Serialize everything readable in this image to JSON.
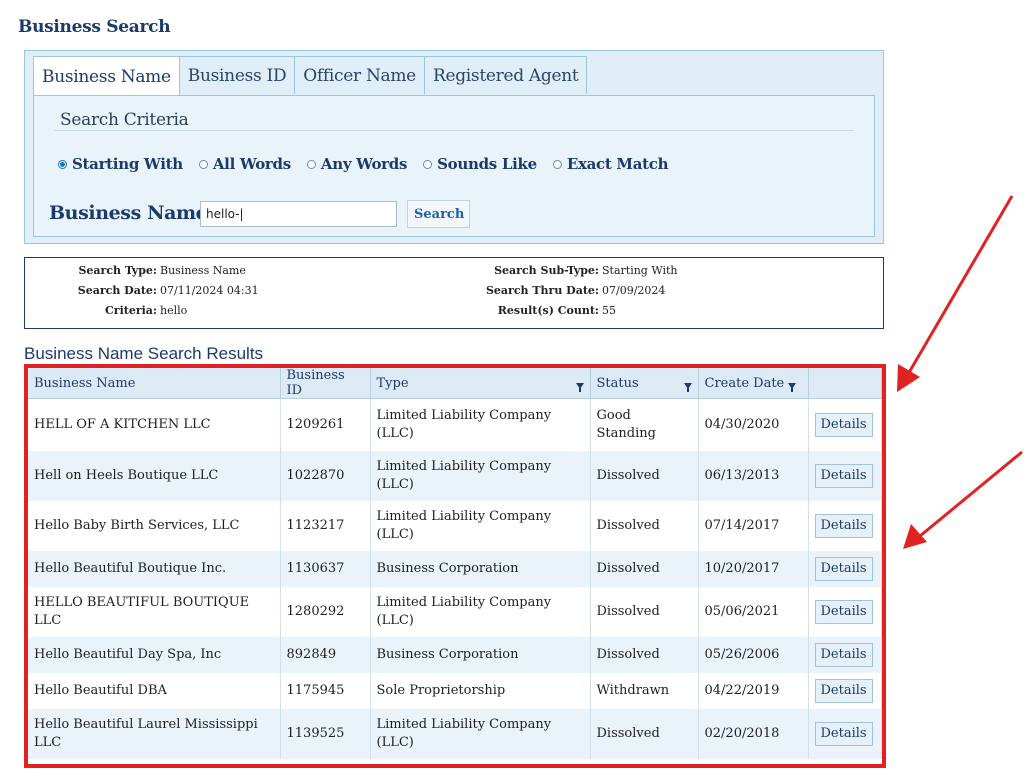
{
  "page": {
    "heading": "Business Search"
  },
  "tabs": [
    {
      "label": "Business Name",
      "active": true
    },
    {
      "label": "Business ID",
      "active": false
    },
    {
      "label": "Officer Name",
      "active": false
    },
    {
      "label": "Registered Agent",
      "active": false
    }
  ],
  "criteria": {
    "title": "Search Criteria",
    "options": [
      {
        "label": "Starting With",
        "checked": true
      },
      {
        "label": "All Words",
        "checked": false
      },
      {
        "label": "Any Words",
        "checked": false
      },
      {
        "label": "Sounds Like",
        "checked": false
      },
      {
        "label": "Exact Match",
        "checked": false
      }
    ],
    "name_label": "Business Name:",
    "name_value": "hello-|",
    "search_label": "Search"
  },
  "summary": {
    "search_type_label": "Search Type:",
    "search_type": "Business Name",
    "search_date_label": "Search Date:",
    "search_date": "07/11/2024 04:31",
    "criteria_label": "Criteria:",
    "criteria": "hello",
    "sub_type_label": "Search Sub-Type:",
    "sub_type": "Starting With",
    "thru_date_label": "Search Thru Date:",
    "thru_date": "07/09/2024",
    "count_label": "Result(s) Count:",
    "count": "55"
  },
  "results": {
    "heading": "Business Name Search Results",
    "columns": [
      "Business Name",
      "Business ID",
      "Type",
      "Status",
      "Create Date",
      ""
    ],
    "details_label": "Details",
    "rows": [
      {
        "name": "HELL OF A KITCHEN LLC",
        "id": "1209261",
        "type": "Limited Liability Company (LLC)",
        "status": "Good Standing",
        "date": "04/30/2020"
      },
      {
        "name": "Hell on Heels Boutique LLC",
        "id": "1022870",
        "type": "Limited Liability Company (LLC)",
        "status": "Dissolved",
        "date": "06/13/2013"
      },
      {
        "name": "Hello Baby Birth Services, LLC",
        "id": "1123217",
        "type": "Limited Liability Company (LLC)",
        "status": "Dissolved",
        "date": "07/14/2017"
      },
      {
        "name": "Hello Beautiful Boutique Inc.",
        "id": "1130637",
        "type": "Business Corporation",
        "status": "Dissolved",
        "date": "10/20/2017"
      },
      {
        "name": "HELLO BEAUTIFUL BOUTIQUE LLC",
        "id": "1280292",
        "type": "Limited Liability Company (LLC)",
        "status": "Dissolved",
        "date": "05/06/2021"
      },
      {
        "name": "Hello Beautiful Day Spa, Inc",
        "id": "892849",
        "type": "Business Corporation",
        "status": "Dissolved",
        "date": "05/26/2006"
      },
      {
        "name": "Hello Beautiful DBA",
        "id": "1175945",
        "type": "Sole Proprietorship",
        "status": "Withdrawn",
        "date": "04/22/2019"
      },
      {
        "name": "Hello Beautiful Laurel Mississippi LLC",
        "id": "1139525",
        "type": "Limited Liability Company (LLC)",
        "status": "Dissolved",
        "date": "02/20/2018"
      }
    ]
  },
  "colors": {
    "accent": "#1b3a6b",
    "highlight_box": "#e02222",
    "panel_bg": "#dfeef7",
    "header_bg": "#dbeaf5"
  }
}
